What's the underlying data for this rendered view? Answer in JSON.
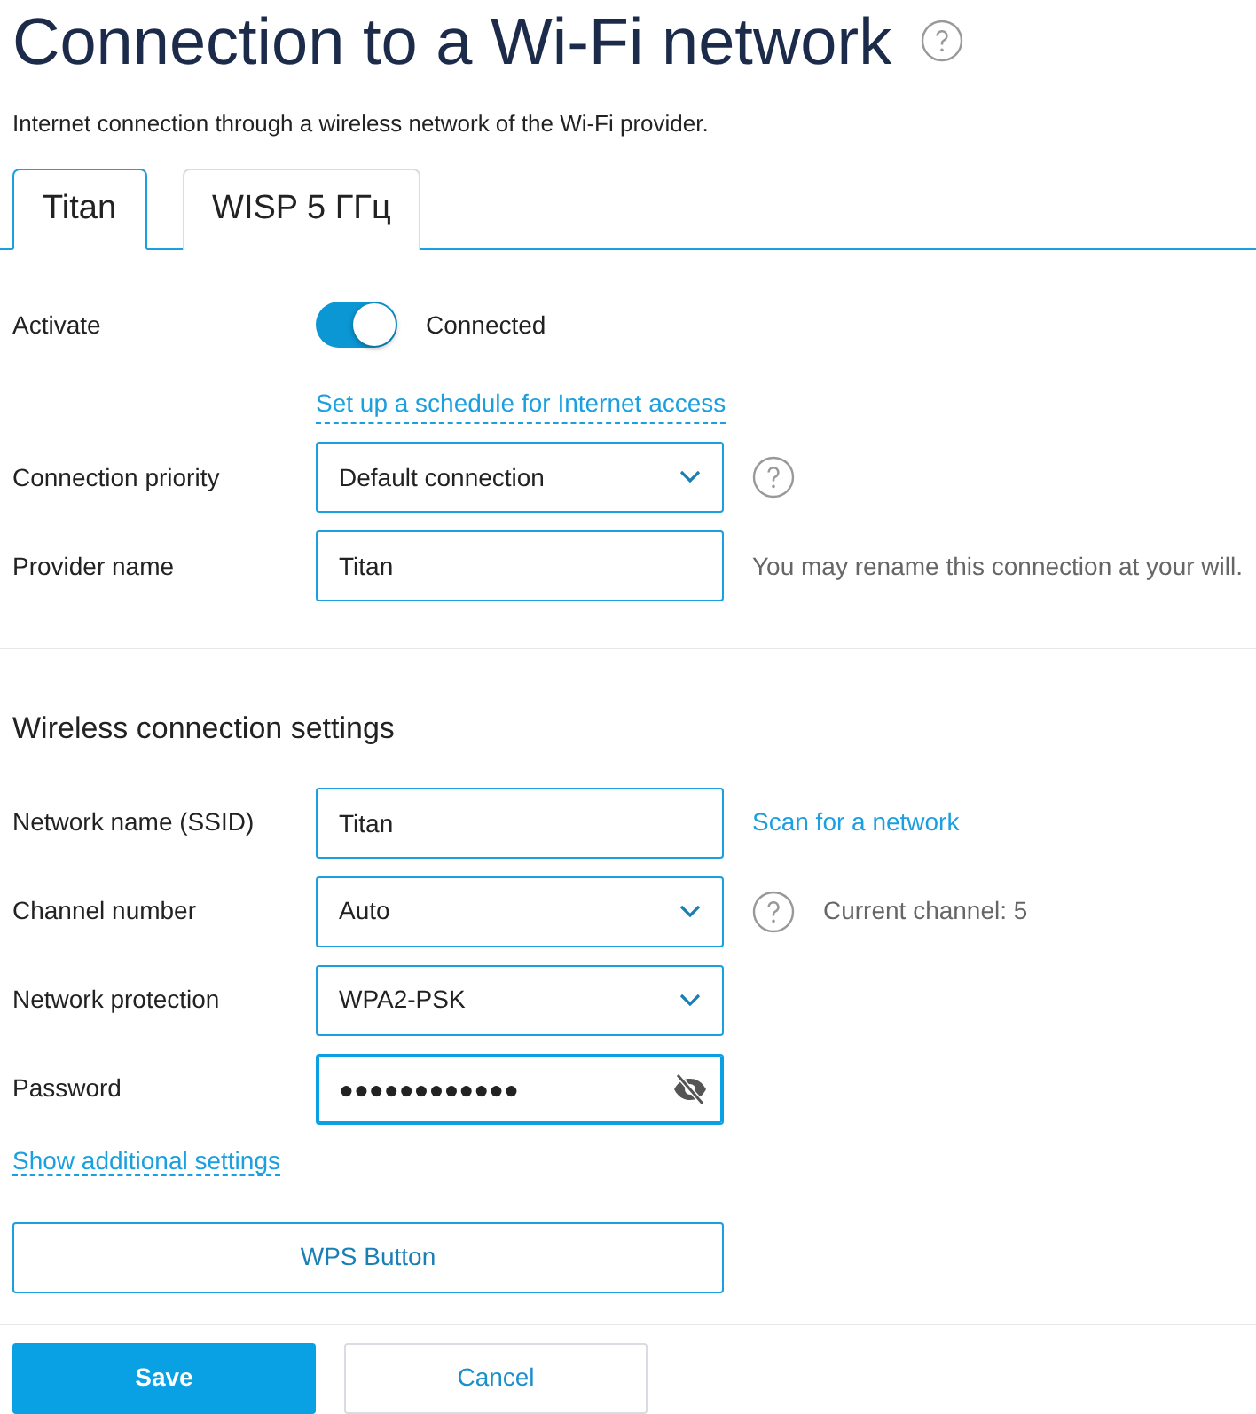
{
  "title": "Connection to a Wi-Fi network",
  "subtitle": "Internet connection through a wireless network of the Wi-Fi provider.",
  "tabs": [
    {
      "label": "Titan",
      "selected": true
    },
    {
      "label": "WISP 5 ГГц",
      "selected": false
    }
  ],
  "activate": {
    "label": "Activate",
    "on": true,
    "status": "Connected",
    "schedule_link": "Set up a schedule for Internet access"
  },
  "general_rows": [
    {
      "kind": "select",
      "label": "Connection priority",
      "value": "Default connection",
      "help": true
    },
    {
      "kind": "text",
      "label": "Provider name",
      "value": "Titan",
      "note": "You may rename this connection at your will."
    }
  ],
  "wireless_heading": "Wireless connection settings",
  "wireless_rows": [
    {
      "kind": "text",
      "label": "Network name (SSID)",
      "value": "Titan",
      "link": "Scan for a network"
    },
    {
      "kind": "select",
      "label": "Channel number",
      "value": "Auto",
      "help": true,
      "note": "Current channel: 5"
    },
    {
      "kind": "select",
      "label": "Network protection",
      "value": "WPA2-PSK"
    },
    {
      "kind": "password",
      "label": "Password",
      "value": "●●●●●●●●●●●●",
      "focused": true
    }
  ],
  "additional_link": "Show additional settings",
  "wps_button": "WPS Button",
  "buttons": [
    {
      "kind": "primary",
      "label": "Save"
    },
    {
      "kind": "secondary",
      "label": "Cancel"
    }
  ]
}
